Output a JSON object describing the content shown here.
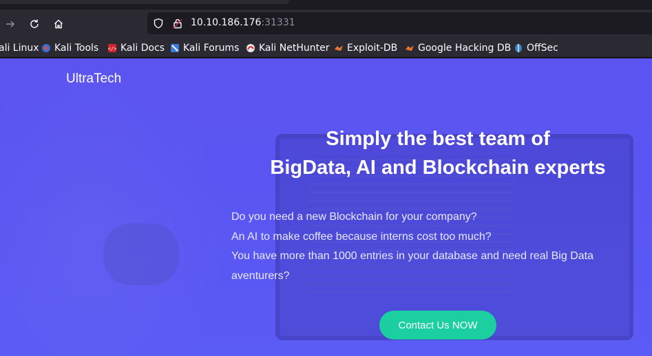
{
  "browser": {
    "url_host": "10.10.186.176",
    "url_port": ":31331",
    "bookmarks": [
      {
        "label": "ali Linux",
        "icon": "kali-linux-icon"
      },
      {
        "label": "Kali Tools",
        "icon": "kali-tools-icon"
      },
      {
        "label": "Kali Docs",
        "icon": "kali-docs-icon"
      },
      {
        "label": "Kali Forums",
        "icon": "kali-forums-icon"
      },
      {
        "label": "Kali NetHunter",
        "icon": "kali-nethunter-icon"
      },
      {
        "label": "Exploit-DB",
        "icon": "exploit-db-icon"
      },
      {
        "label": "Google Hacking DB",
        "icon": "google-hacking-db-icon"
      },
      {
        "label": "OffSec",
        "icon": "offsec-icon"
      }
    ]
  },
  "site": {
    "brand": "UltraTech",
    "headline_line1": "Simply the best team of",
    "headline_line2": "BigData, AI and Blockchain experts",
    "paragraphs": [
      "Do you need a new Blockchain for your company?",
      "An AI to make coffee because interns cost too much?",
      "You have more than 1000 entries in your database and need real Big Data aventurers?"
    ],
    "cta_label": "Contact Us NOW"
  },
  "colors": {
    "page_bg": "#5c54f0",
    "cta_bg": "#1ccfa0",
    "chrome_bg": "#2b2a33"
  }
}
